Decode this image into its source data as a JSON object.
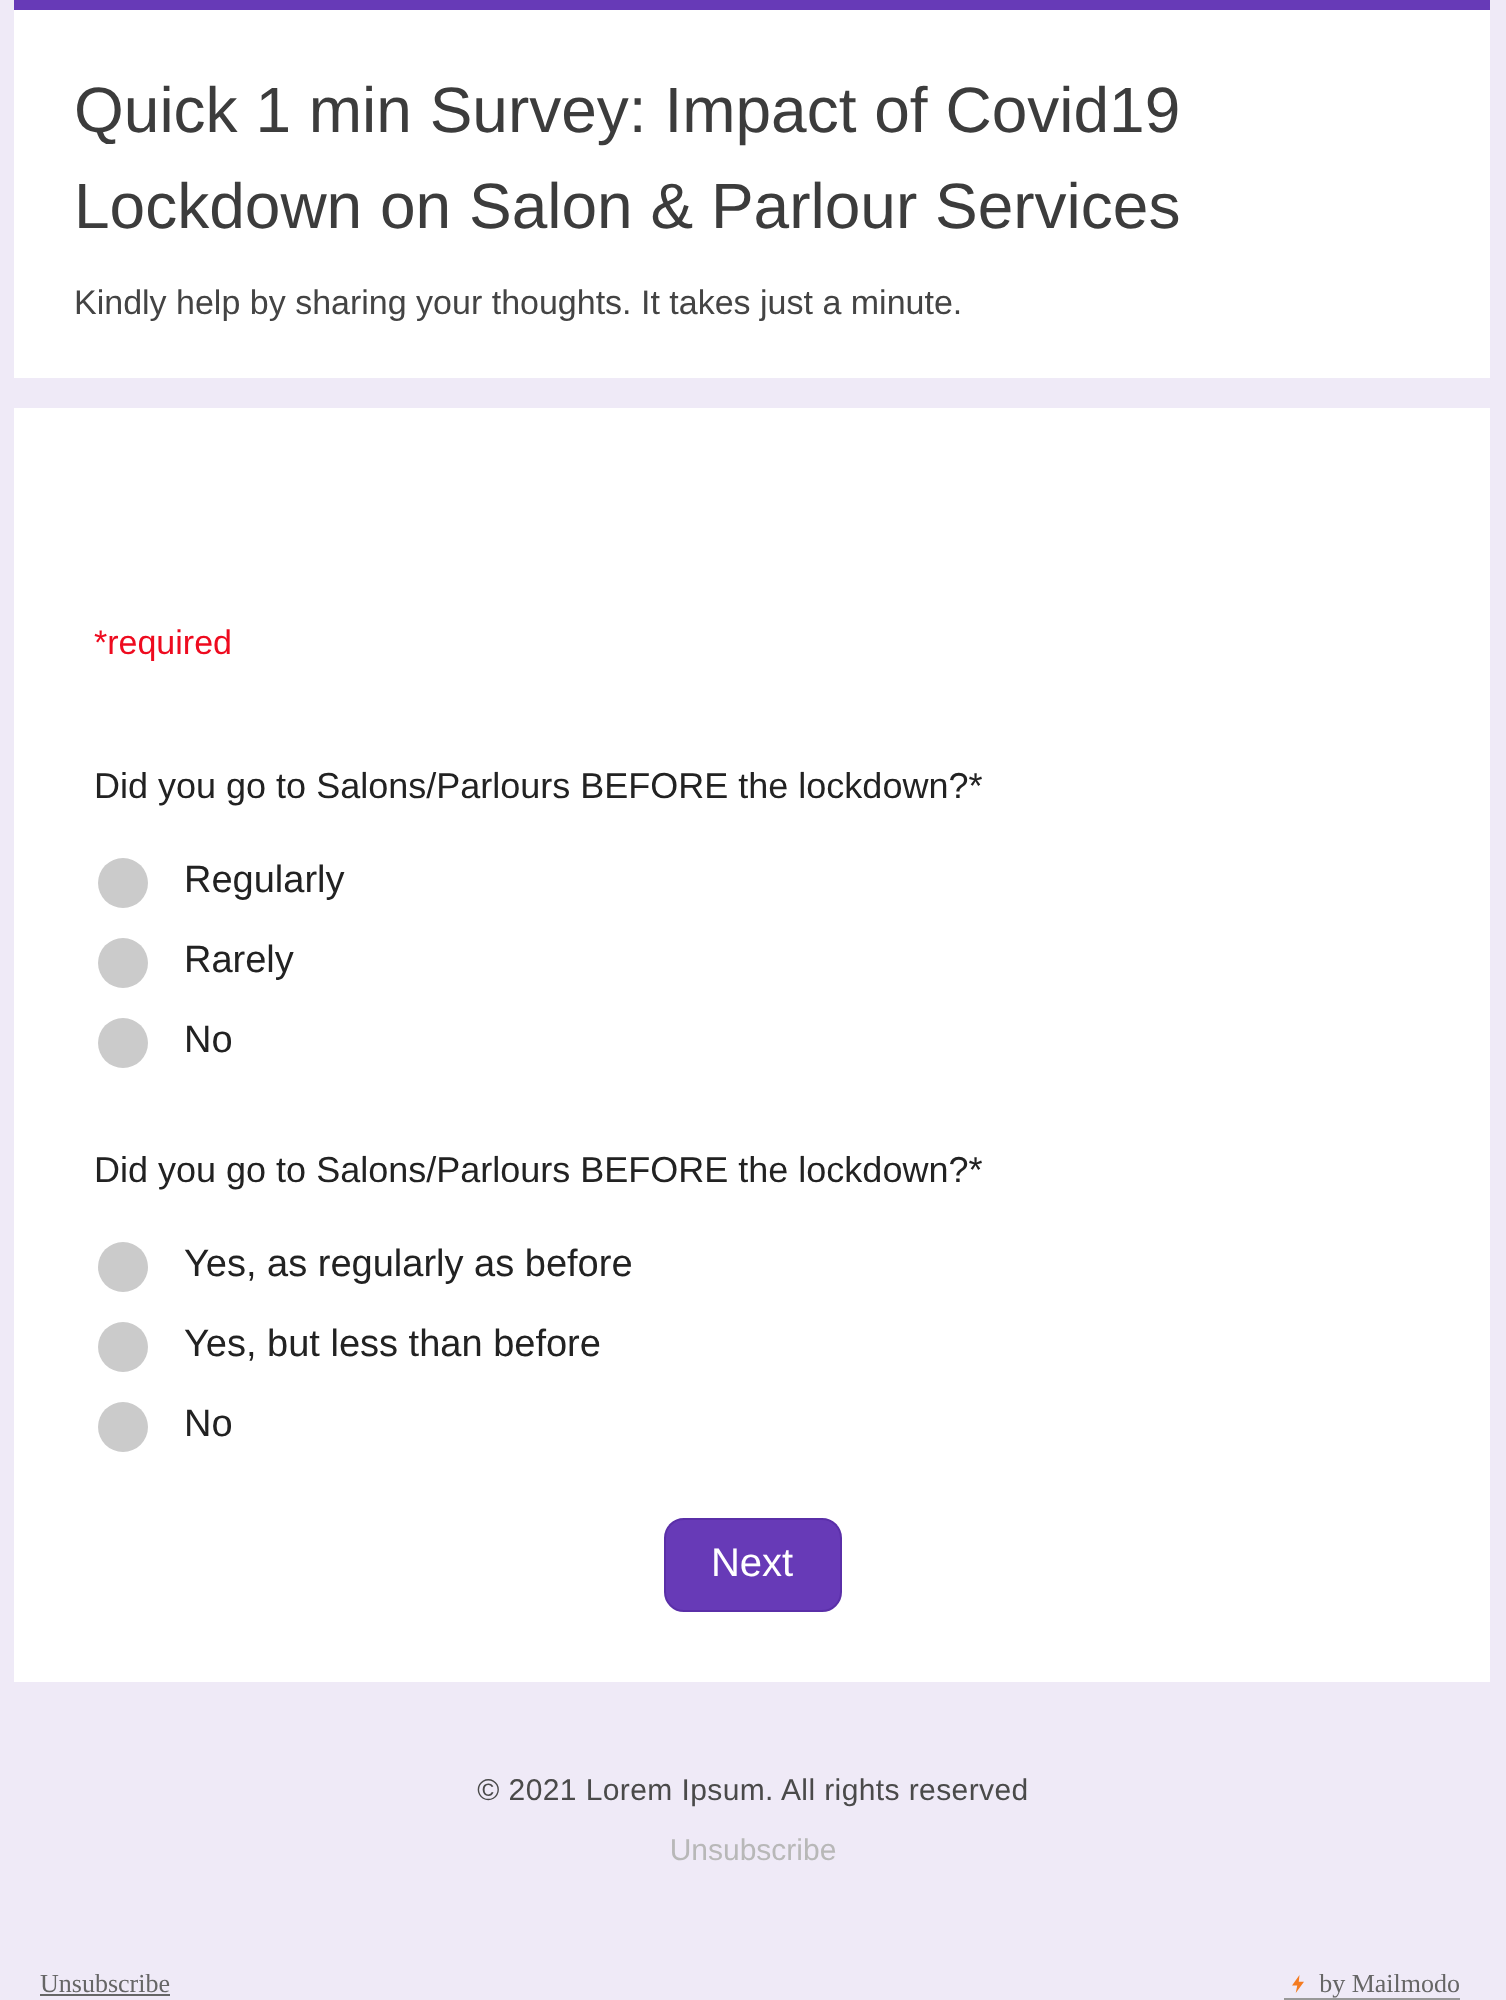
{
  "header": {
    "title": "Quick 1 min Survey: Impact of Covid19 Lockdown on Salon & Parlour Services",
    "description": "Kindly help by sharing your thoughts. It takes just a minute."
  },
  "form": {
    "required_note": "*required",
    "questions": [
      {
        "text": "Did you go to Salons/Parlours BEFORE the lockdown?*",
        "options": [
          {
            "label": "Regularly",
            "selected": false
          },
          {
            "label": "Rarely",
            "selected": false
          },
          {
            "label": "No",
            "selected": false
          }
        ]
      },
      {
        "text": "Did you go to Salons/Parlours BEFORE the lockdown?*",
        "options": [
          {
            "label": "Yes, as regularly as before",
            "selected": false
          },
          {
            "label": "Yes, but less than before",
            "selected": false
          },
          {
            "label": "No",
            "selected": false
          }
        ]
      }
    ],
    "next_button": "Next"
  },
  "footer": {
    "copyright": "© 2021 Lorem Ipsum. All rights reserved",
    "unsubscribe": "Unsubscribe"
  },
  "bottom_bar": {
    "unsubscribe": "Unsubscribe",
    "credit": "by Mailmodo"
  }
}
